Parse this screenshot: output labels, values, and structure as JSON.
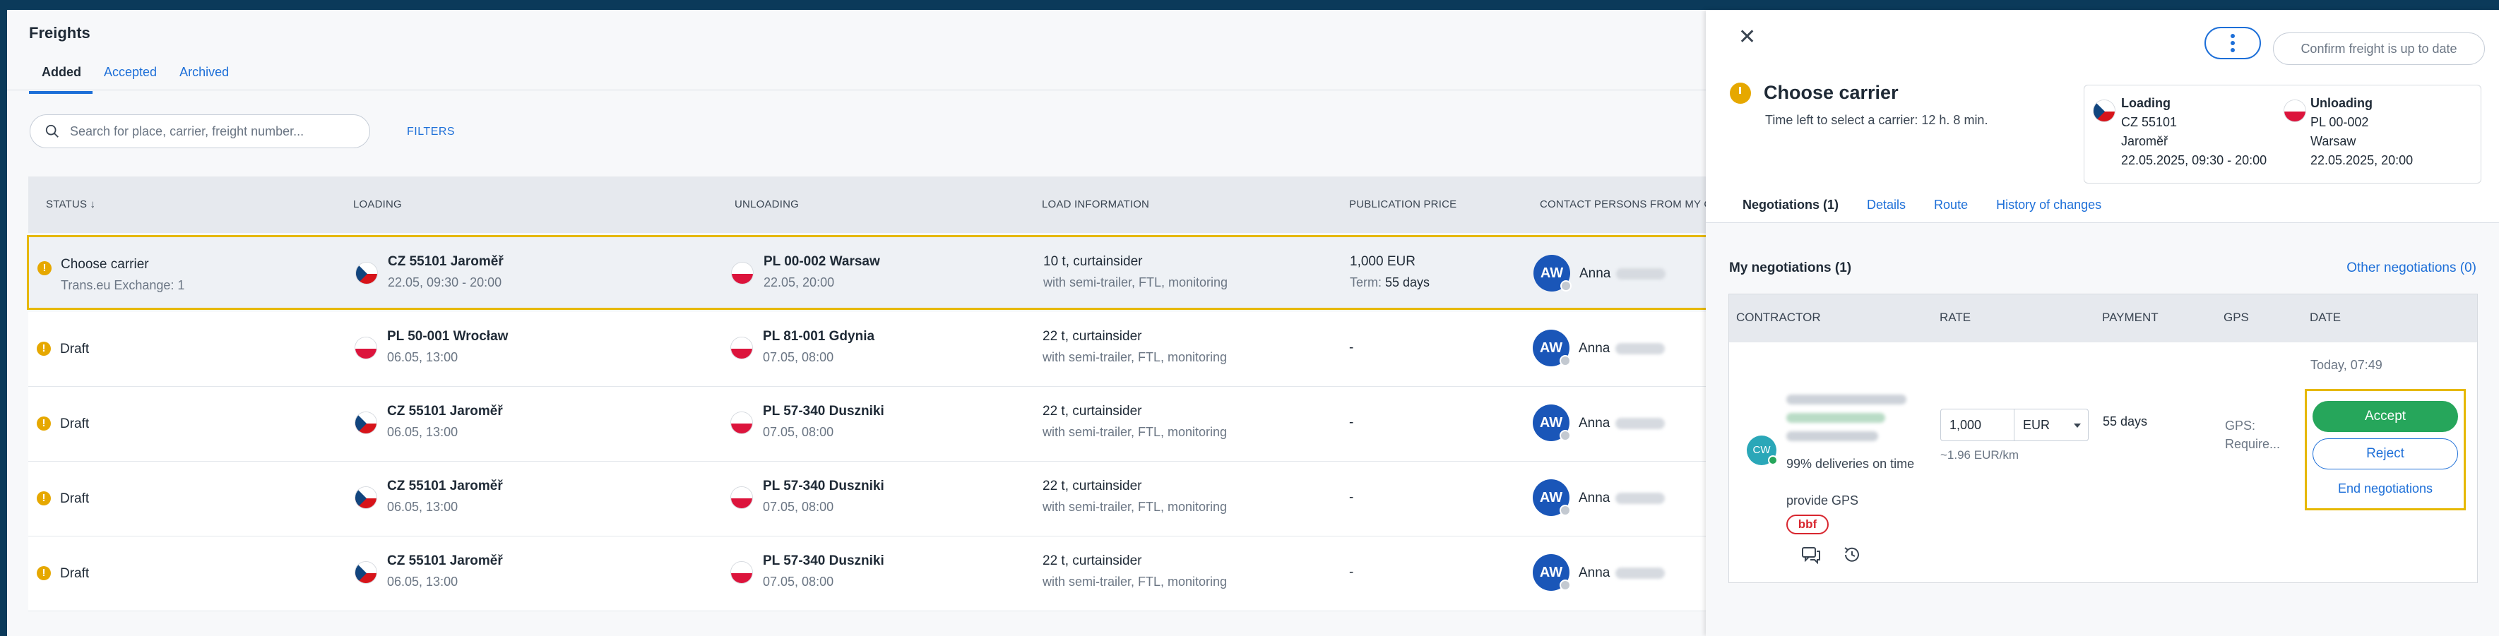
{
  "page": {
    "title": "Freights",
    "tabs": [
      "Added",
      "Accepted",
      "Archived"
    ],
    "search_placeholder": "Search for place, carrier, freight number...",
    "filters_label": "FILTERS"
  },
  "table": {
    "headers": [
      "STATUS",
      "LOADING",
      "UNLOADING",
      "LOAD INFORMATION",
      "PUBLICATION PRICE",
      "CONTACT PERSONS FROM MY COMP"
    ],
    "rows": [
      {
        "status": "Choose carrier",
        "status_sub": "Trans.eu Exchange: 1",
        "loading_flag": "cz",
        "loading_place": "CZ 55101 Jaroměř",
        "loading_date": "22.05, 09:30 - 20:00",
        "unloading_flag": "pl",
        "unloading_place": "PL 00-002 Warsaw",
        "unloading_date": "22.05, 20:00",
        "load_info": "10 t, curtainsider",
        "load_sub": "with semi-trailer, FTL, monitoring",
        "price": "1,000 EUR",
        "term_label": "Term:",
        "term": "55 days",
        "avatar": "AW",
        "contact": "Anna"
      },
      {
        "status": "Draft",
        "status_sub": "",
        "loading_flag": "pl",
        "loading_place": "PL 50-001 Wrocław",
        "loading_date": "06.05, 13:00",
        "unloading_flag": "pl",
        "unloading_place": "PL 81-001 Gdynia",
        "unloading_date": "07.05, 08:00",
        "load_info": "22 t, curtainsider",
        "load_sub": "with semi-trailer, FTL, monitoring",
        "price": "-",
        "term_label": "",
        "term": "",
        "avatar": "AW",
        "contact": "Anna"
      },
      {
        "status": "Draft",
        "status_sub": "",
        "loading_flag": "cz",
        "loading_place": "CZ 55101 Jaroměř",
        "loading_date": "06.05, 13:00",
        "unloading_flag": "pl",
        "unloading_place": "PL 57-340 Duszniki",
        "unloading_date": "07.05, 08:00",
        "load_info": "22 t, curtainsider",
        "load_sub": "with semi-trailer, FTL, monitoring",
        "price": "-",
        "term_label": "",
        "term": "",
        "avatar": "AW",
        "contact": "Anna"
      },
      {
        "status": "Draft",
        "status_sub": "",
        "loading_flag": "cz",
        "loading_place": "CZ 55101 Jaroměř",
        "loading_date": "06.05, 13:00",
        "unloading_flag": "pl",
        "unloading_place": "PL 57-340 Duszniki",
        "unloading_date": "07.05, 08:00",
        "load_info": "22 t, curtainsider",
        "load_sub": "with semi-trailer, FTL, monitoring",
        "price": "-",
        "term_label": "",
        "term": "",
        "avatar": "AW",
        "contact": "Anna"
      },
      {
        "status": "Draft",
        "status_sub": "",
        "loading_flag": "cz",
        "loading_place": "CZ 55101 Jaroměř",
        "loading_date": "06.05, 13:00",
        "unloading_flag": "pl",
        "unloading_place": "PL 57-340 Duszniki",
        "unloading_date": "07.05, 08:00",
        "load_info": "22 t, curtainsider",
        "load_sub": "with semi-trailer, FTL, monitoring",
        "price": "-",
        "term_label": "",
        "term": "",
        "avatar": "AW",
        "contact": "Anna"
      }
    ]
  },
  "panel": {
    "confirm_label": "Confirm freight is up to date",
    "title": "Choose carrier",
    "subtitle": "Time left to select a carrier: 12 h. 8 min.",
    "loading": {
      "header": "Loading",
      "flag": "cz",
      "code": "CZ 55101",
      "city": "Jaroměř",
      "date": "22.05.2025, 09:30 - 20:00"
    },
    "unloading": {
      "header": "Unloading",
      "flag": "pl",
      "code": "PL 00-002",
      "city": "Warsaw",
      "date": "22.05.2025, 20:00"
    },
    "tabs": [
      "Negotiations (1)",
      "Details",
      "Route",
      "History of changes"
    ],
    "my_negotiations": "My negotiations (1)",
    "other_negotiations": "Other negotiations (0)",
    "neg_headers": [
      "CONTRACTOR",
      "RATE",
      "PAYMENT",
      "GPS",
      "DATE"
    ],
    "negotiation": {
      "avatar": "CW",
      "deliveries": "99% deliveries on time",
      "provide_gps": "provide GPS",
      "badge": "bbf",
      "rate": "1,000",
      "currency": "EUR",
      "per_km": "~1.96 EUR/km",
      "payment": "55 days",
      "gps_line1": "GPS:",
      "gps_line2": "Require...",
      "date": "Today, 07:49",
      "accept": "Accept",
      "reject": "Reject",
      "end": "End negotiations"
    }
  },
  "colors": {
    "accent": "#1d6fd8",
    "warning": "#e6a800",
    "success": "#26a65b",
    "highlight": "#e6b800"
  }
}
